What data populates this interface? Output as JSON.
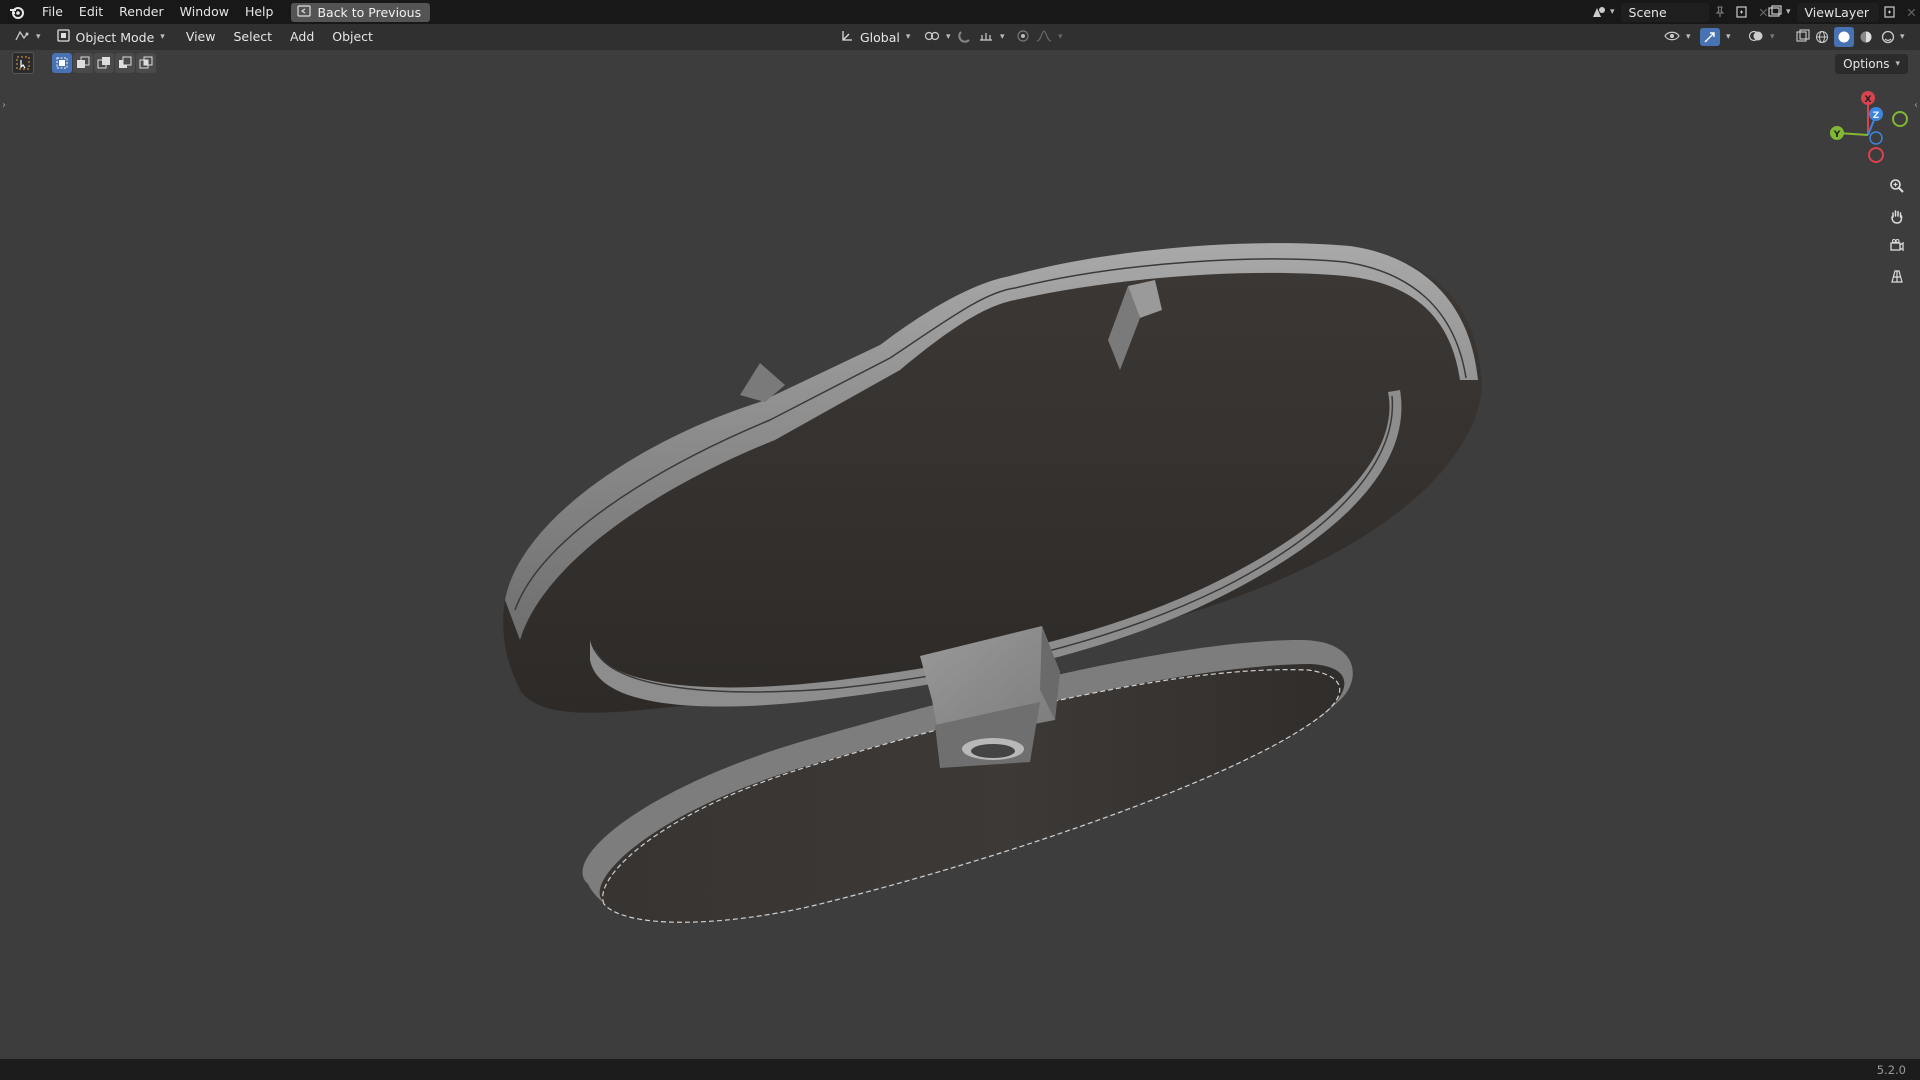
{
  "topbar": {
    "menus": [
      "File",
      "Edit",
      "Render",
      "Window",
      "Help"
    ],
    "back_label": "Back to Previous",
    "scene_name": "Scene",
    "viewlayer_name": "ViewLayer"
  },
  "header": {
    "mode_label": "Object Mode",
    "menus": [
      "View",
      "Select",
      "Add",
      "Object"
    ],
    "orientation_label": "Global",
    "options_label": "Options"
  },
  "gizmo": {
    "x": "X",
    "y": "Y",
    "z": "Z"
  },
  "status": {
    "version": "5.2.0"
  },
  "colors": {
    "viewport_bg": "#3d3d3d",
    "axis_x": "#d8434f",
    "axis_y": "#82b833",
    "axis_z": "#3d86dd",
    "active_blue": "#4772b3"
  },
  "icons": [
    "blender-logo",
    "editor-type-icon",
    "object-mode-icon",
    "transform-orientation-icon",
    "snap-icon",
    "proportional-edit-icon",
    "zoom-icon",
    "hand-pan-icon",
    "camera-view-icon",
    "ortho-grid-icon",
    "scene-icon",
    "viewlayer-icon",
    "new-scene-icon",
    "new-viewlayer-icon",
    "select-box-icon",
    "visibility-icon",
    "gizmo-icon",
    "overlay-icon",
    "xray-icon",
    "wireframe-shading-icon",
    "solid-shading-icon",
    "material-shading-icon",
    "rendered-shading-icon"
  ]
}
